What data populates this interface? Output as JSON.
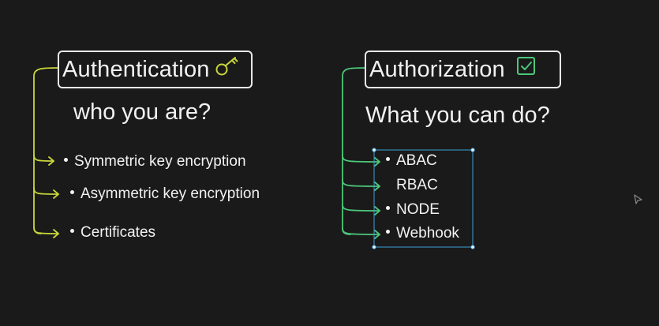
{
  "colors": {
    "background": "#1a1a1a",
    "text": "#f2f2f2",
    "auth_connector": "#c9d63a",
    "authz_connector": "#4cc77a",
    "selection_box": "#3aa0d8",
    "checkbox_icon": "#4cc77a"
  },
  "authentication": {
    "title": "Authentication",
    "icon": "key-icon",
    "question": "who you are?",
    "items": [
      "Symmetric key encryption",
      "Asymmetric key encryption",
      "Certificates"
    ]
  },
  "authorization": {
    "title": "Authorization",
    "icon": "checkbox-icon",
    "question": "What you can do?",
    "items": [
      "ABAC",
      "RBAC",
      "NODE",
      "Webhook"
    ]
  }
}
